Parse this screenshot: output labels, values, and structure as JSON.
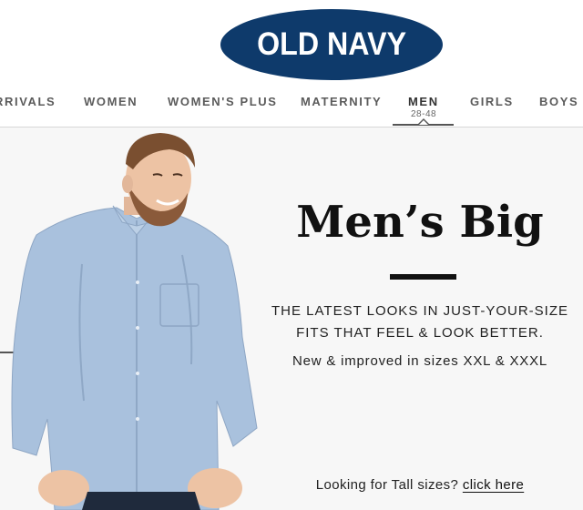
{
  "brand": {
    "logo_text": "OLD NAVY",
    "logo_color": "#0e3a6b"
  },
  "nav": {
    "items": [
      {
        "label": "RRIVALS"
      },
      {
        "label": "WOMEN"
      },
      {
        "label": "WOMEN'S PLUS"
      },
      {
        "label": "MATERNITY"
      },
      {
        "label": "MEN",
        "sublabel": "28-48",
        "active": true
      },
      {
        "label": "GIRLS"
      },
      {
        "label": "BOYS"
      }
    ]
  },
  "hero": {
    "headline": "Men’s Big",
    "tagline_1": "THE LATEST LOOKS IN JUST-YOUR-SIZE",
    "tagline_2": "FITS THAT FEEL & LOOK BETTER.",
    "tagline_3": "New & improved in sizes XXL & XXXL",
    "tall_prompt": "Looking for Tall sizes?",
    "tall_link": "click here",
    "background_color": "#f7f7f7",
    "shirt_color": "#a9c1dd"
  }
}
